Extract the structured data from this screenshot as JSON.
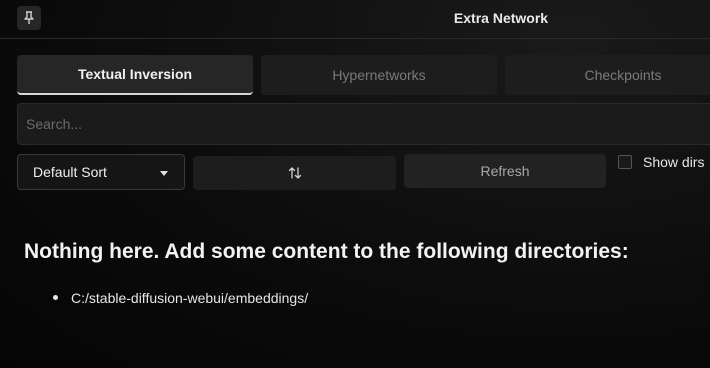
{
  "header": {
    "title": "Extra Network",
    "pin_icon": "pin-icon"
  },
  "tabs": [
    {
      "label": "Textual Inversion",
      "active": true
    },
    {
      "label": "Hypernetworks",
      "active": false
    },
    {
      "label": "Checkpoints",
      "active": false
    }
  ],
  "search": {
    "placeholder": "Search...",
    "value": ""
  },
  "controls": {
    "sort_selected": "Default Sort",
    "sort_direction_icon": "sort-direction-icon",
    "refresh_label": "Refresh",
    "show_dirs_label": "Show dirs",
    "show_dirs_checked": false
  },
  "empty": {
    "title": "Nothing here. Add some content to the following directories:",
    "directories": [
      "C:/stable-diffusion-webui/embeddings/"
    ]
  }
}
